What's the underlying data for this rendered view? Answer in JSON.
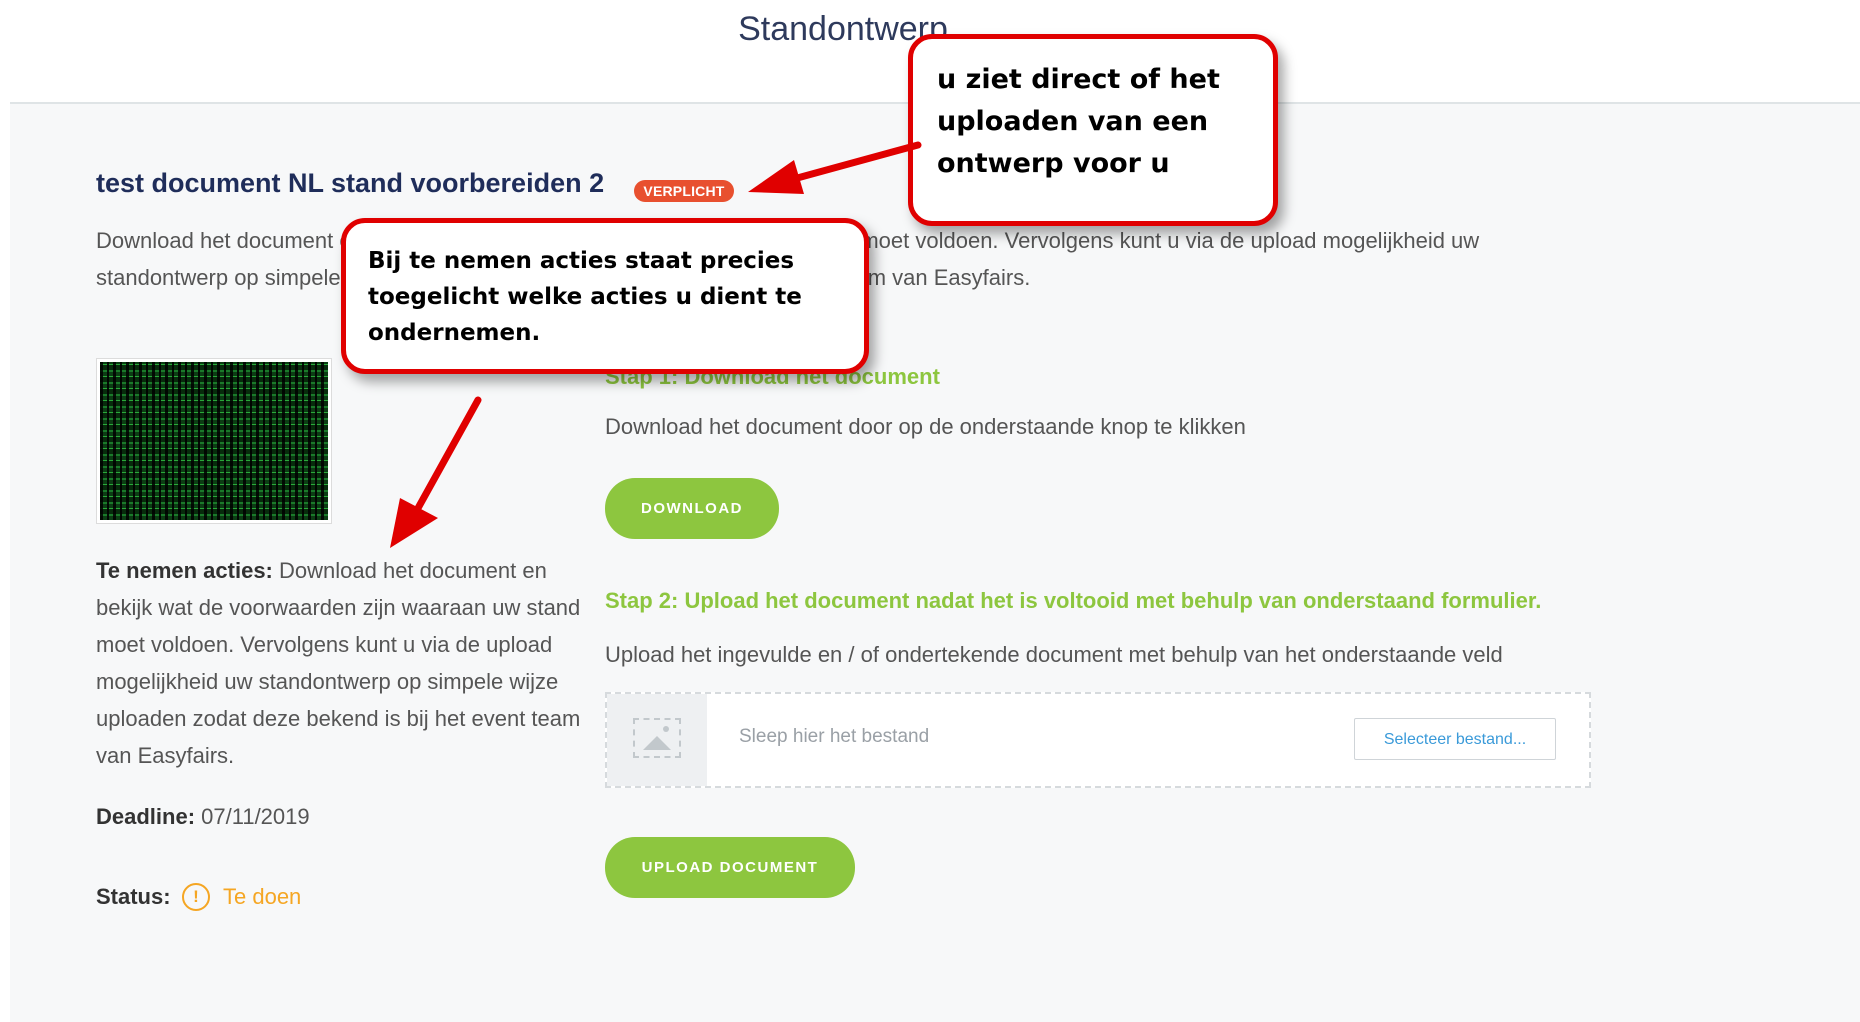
{
  "header": {
    "title": "Standontwerp"
  },
  "document": {
    "title": "test document NL stand voorbereiden 2",
    "badge": "VERPLICHT",
    "description": "Download het document en bekijk wat de voorwaarden zijn waaraan uw stand moet voldoen. Vervolgens kunt u via de upload mogelijkheid uw standontwerp op simpele wijze uploaden zodat deze bekend is bij het event team van Easyfairs."
  },
  "sidebar": {
    "actions_label": "Te nemen acties:",
    "actions_text": " Download het document en bekijk wat de voorwaarden zijn waaraan uw stand moet voldoen. Vervolgens kunt u via de upload mogelijkheid uw standontwerp op simpele wijze uploaden zodat deze bekend is bij het event team van Easyfairs.",
    "deadline_label": "Deadline:",
    "deadline_value": " 07/11/2019",
    "status_label": "Status:",
    "status_icon": "!",
    "status_value": "Te doen",
    "status_color": "#f5a623"
  },
  "steps": {
    "step1_title": "Stap 1: Download het document",
    "step1_desc": "Download het document door op de onderstaande knop te klikken",
    "download_button": "DOWNLOAD",
    "step2_title": "Stap 2: Upload het document nadat het is voltooid met behulp van onderstaand formulier.",
    "step2_desc": "Upload het ingevulde en / of ondertekende document met behulp van het onderstaande veld",
    "dropzone_text": "Sleep hier het bestand",
    "select_button": "Selecteer bestand...",
    "upload_button": "UPLOAD DOCUMENT"
  },
  "annotations": {
    "callout_top": "u ziet direct of het uploaden van een ontwerp voor u",
    "callout_mid": "Bij te nemen acties staat precies toegelicht welke acties u dient te ondernemen."
  },
  "colors": {
    "accent_green": "#8dc63f",
    "badge_red": "#e8502f",
    "title_navy": "#1f2d5a",
    "annotation_red": "#e00000"
  }
}
